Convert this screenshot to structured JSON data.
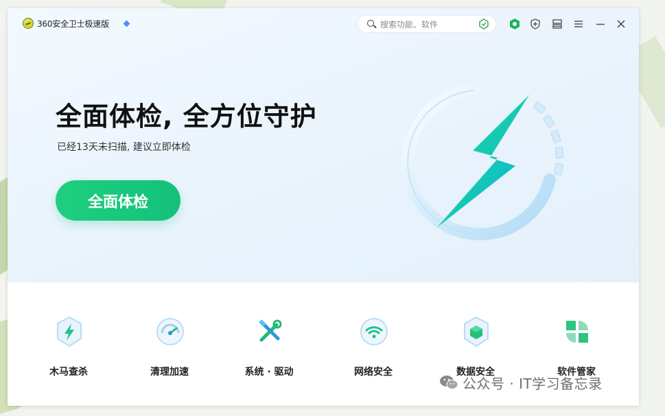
{
  "app": {
    "title": "360安全卫士极速版"
  },
  "search": {
    "placeholder": "搜索功能、软件"
  },
  "hero": {
    "title": "全面体检, 全方位守护",
    "subtitle": "已经13天未扫描, 建议立即体检",
    "button_label": "全面体检"
  },
  "tools": [
    {
      "label": "木马查杀",
      "icon": "trojan-shield-icon"
    },
    {
      "label": "清理加速",
      "icon": "clean-speed-icon"
    },
    {
      "label": "系统 · 驱动",
      "icon": "system-driver-tools-icon"
    },
    {
      "label": "网络安全",
      "icon": "wifi-security-icon"
    },
    {
      "label": "数据安全",
      "icon": "data-security-icon"
    },
    {
      "label": "软件管家",
      "icon": "software-manager-icon"
    }
  ],
  "watermark": {
    "text": "公众号 · IT学习备忘录"
  },
  "colors": {
    "accent": "#14c07a",
    "titlebar_icon_green": "#19b35a",
    "text_dark": "#111111"
  }
}
